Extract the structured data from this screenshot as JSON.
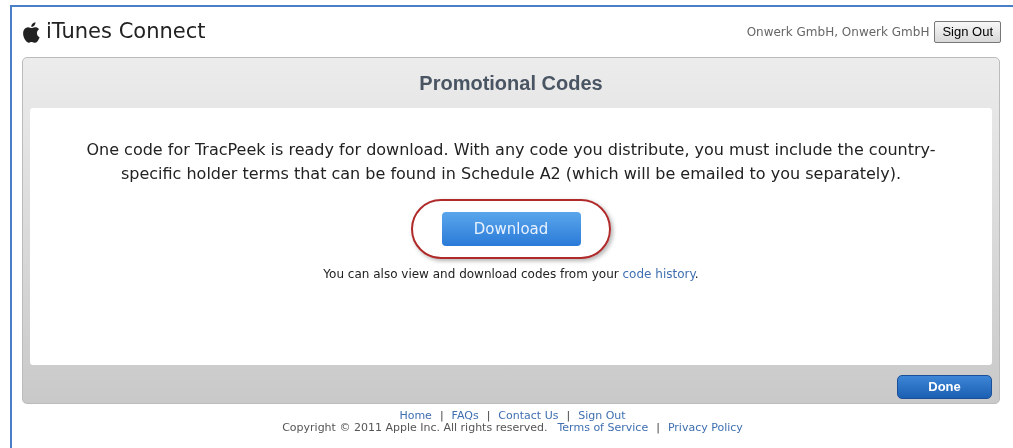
{
  "header": {
    "logo_text": "iTunes Connect",
    "account": "Onwerk GmbH, Onwerk GmbH",
    "sign_out": "Sign Out"
  },
  "panel": {
    "title": "Promotional Codes",
    "message": "One code for TracPeek is ready for download. With any code you distribute, you must include the country-specific holder terms that can be found in Schedule A2 (which will be emailed to you separately).",
    "download": "Download",
    "history_before": "You can also view and download codes from your ",
    "history_link": "code history",
    "history_after": ".",
    "done": "Done"
  },
  "footer": {
    "separator": "|",
    "links": [
      "Home",
      "FAQs",
      "Contact Us",
      "Sign Out"
    ],
    "copyright": "Copyright © 2011 Apple Inc. All rights reserved.",
    "legal_links": [
      "Terms of Service",
      "Privacy Policy"
    ]
  }
}
